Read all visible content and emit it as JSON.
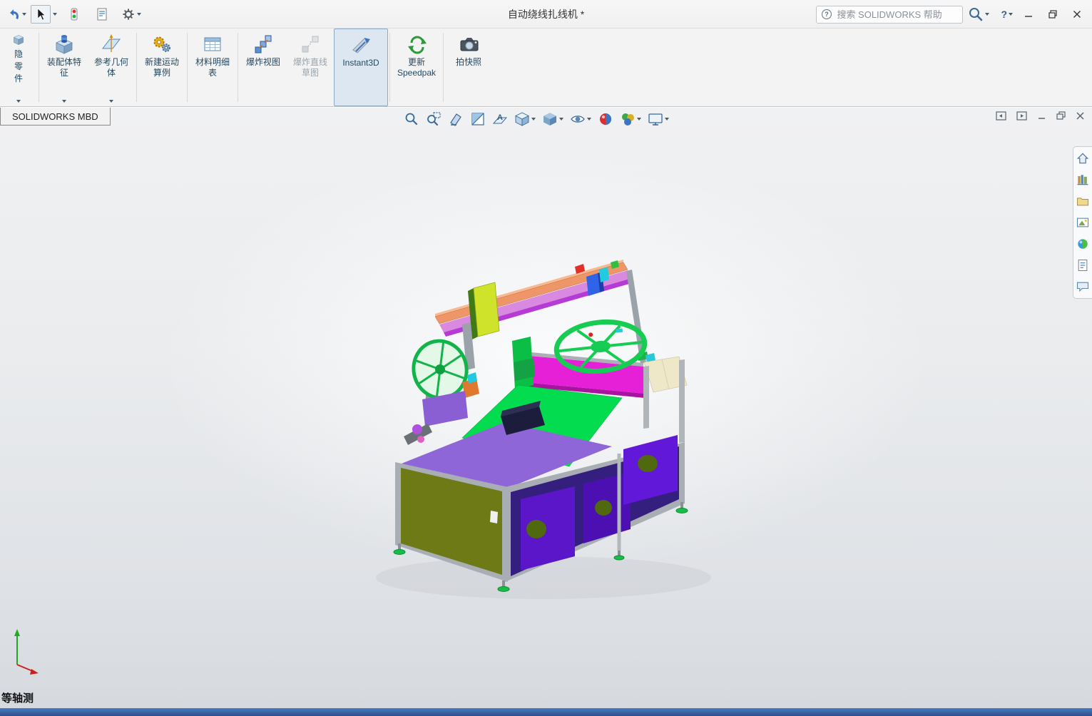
{
  "app": {
    "title": "自动绕线扎线机 *"
  },
  "titlebar": {
    "search_placeholder": "搜索 SOLIDWORKS 帮助",
    "help_label": "?"
  },
  "ribbon": {
    "partial_button": {
      "label": "隐零件"
    },
    "buttons": [
      {
        "label": "装配体特征"
      },
      {
        "label": "参考几何体"
      },
      {
        "label": "新建运动算例"
      },
      {
        "label": "材料明细表"
      },
      {
        "label": "爆炸视图"
      },
      {
        "label": "爆炸直线草图"
      },
      {
        "label": "Instant3D"
      },
      {
        "label": "更新 Speedpak"
      },
      {
        "label": "拍快照"
      }
    ]
  },
  "mbd_tab": {
    "label": "SOLIDWORKS MBD"
  },
  "viewport": {
    "orientation_label": "等轴测"
  },
  "colors": {
    "status_bar": "#2c4f8a",
    "active_button_bg": "#dde7f2",
    "model_purple": "#8f66d8",
    "model_green": "#04dc50",
    "model_magenta": "#e520d6",
    "model_olive": "#6d7a15"
  },
  "icons": {
    "quick_access": [
      "undo-icon",
      "select-arrow-icon",
      "rebuild-icon",
      "file-properties-icon",
      "options-gear-icon"
    ],
    "titlebar_right": [
      "search-help-icon",
      "search-magnifier-icon",
      "help-icon",
      "minimize-icon",
      "maximize-icon",
      "close-icon"
    ],
    "heads_up": [
      "zoom-fit-icon",
      "zoom-area-icon",
      "previous-view-icon",
      "section-view-icon",
      "annotation-views-icon",
      "view-orientation-icon",
      "display-style-icon",
      "hide-show-items-icon",
      "edit-appearance-icon",
      "apply-scene-icon",
      "view-settings-icon"
    ],
    "doc_window": [
      "pane-left-icon",
      "pane-right-icon",
      "doc-minimize-icon",
      "doc-restore-icon",
      "doc-close-icon"
    ],
    "task_pane": [
      "home-icon",
      "design-library-icon",
      "file-explorer-icon",
      "view-palette-icon",
      "appearances-icon",
      "custom-properties-icon",
      "forum-icon"
    ]
  }
}
